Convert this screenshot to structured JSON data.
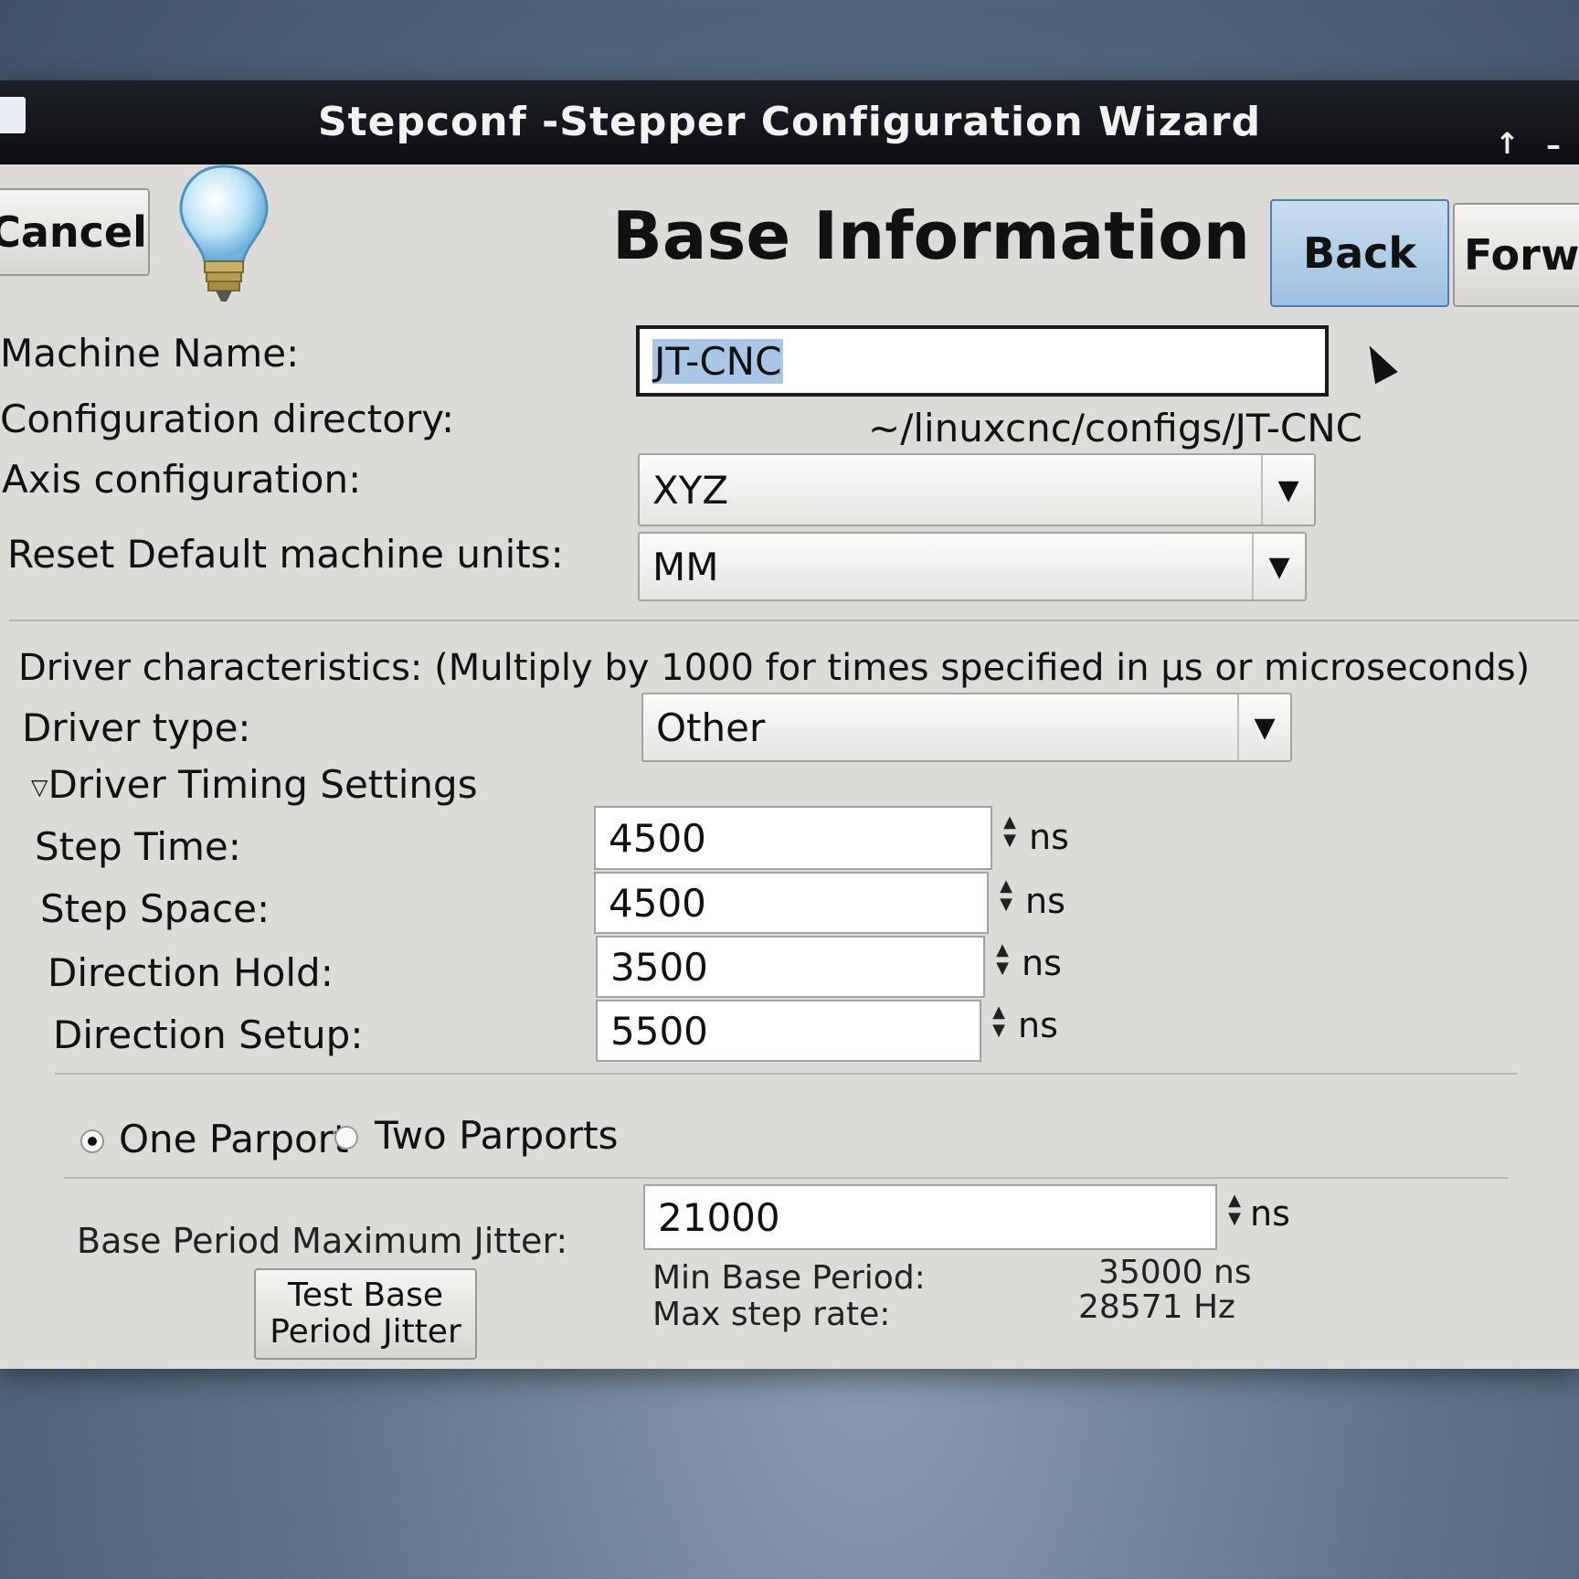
{
  "window": {
    "title": "Stepconf -Stepper Configuration Wizard",
    "titlebar_buttons": [
      "↑",
      "–"
    ]
  },
  "toolbar": {
    "cancel_label": "Cancel",
    "back_label": "Back",
    "forward_label": "Forwa",
    "page_title": "Base Information",
    "bulb_icon": "lightbulb-icon"
  },
  "form": {
    "machine_name_label": "Machine Name:",
    "machine_name_value": "JT-CNC",
    "config_dir_label": "Configuration directory:",
    "config_dir_value": "~/linuxcnc/configs/JT-CNC",
    "axis_label": "Axis configuration:",
    "axis_value": "XYZ",
    "units_label": "Reset Default machine units:",
    "units_value": "MM"
  },
  "driver": {
    "heading": "Driver characteristics: (Multiply by 1000 for times specified in µs or microseconds)",
    "type_label": "Driver type:",
    "type_value": "Other",
    "timing_expander": "Driver Timing Settings",
    "step_time_label": "Step Time:",
    "step_time_value": "4500",
    "step_space_label": "Step Space:",
    "step_space_value": "4500",
    "dir_hold_label": "Direction Hold:",
    "dir_hold_value": "3500",
    "dir_setup_label": "Direction Setup:",
    "dir_setup_value": "5500",
    "unit": "ns"
  },
  "parport": {
    "one_label": "One Parport",
    "two_label": "Two Parports",
    "selected": "one"
  },
  "jitter": {
    "label": "Base Period Maximum Jitter:",
    "value": "21000",
    "unit": "ns",
    "test_button_line1": "Test Base",
    "test_button_line2": "Period Jitter",
    "min_base_period_label": "Min Base Period:",
    "min_base_period_value": "35000 ns",
    "max_step_rate_label": "Max step rate:",
    "max_step_rate_value": "28571 Hz"
  }
}
